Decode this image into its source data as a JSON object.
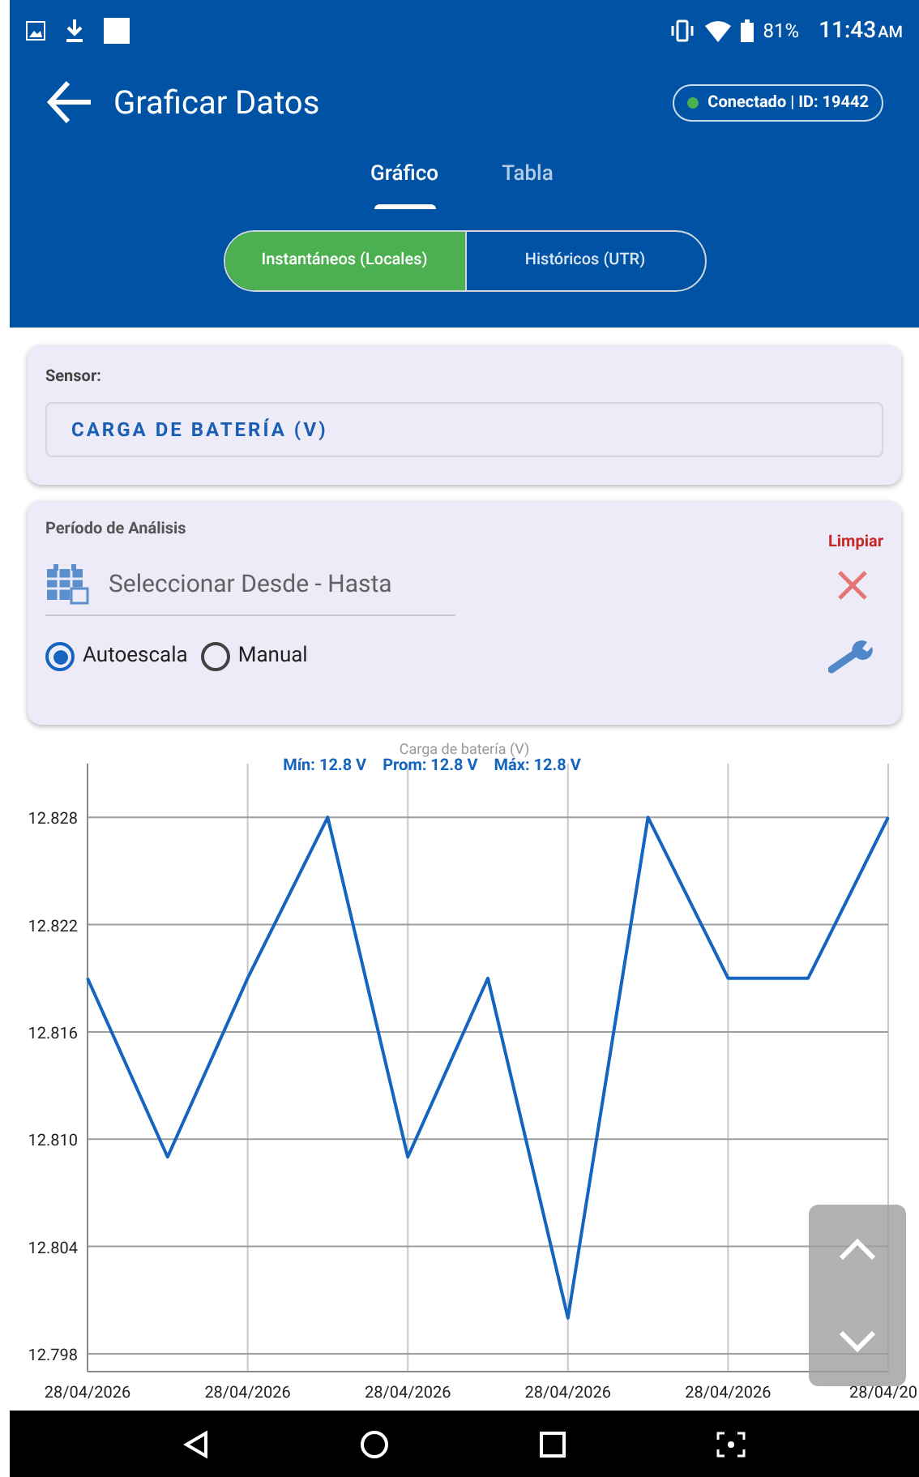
{
  "status_bar": {
    "battery": "81%",
    "time": "11:43",
    "meridiem": "AM"
  },
  "header": {
    "title": "Graficar Datos",
    "connection": {
      "label": "Conectado | ID: 19442",
      "connected": true
    }
  },
  "tabs": [
    {
      "label": "Gráfico",
      "selected": true
    },
    {
      "label": "Tabla",
      "selected": false
    }
  ],
  "source_toggle": [
    {
      "label": "Instantáneos (Locales)",
      "selected": true
    },
    {
      "label": "Históricos (UTR)",
      "selected": false
    }
  ],
  "sensor": {
    "label": "Sensor:",
    "value": "CARGA DE BATERÍA (V)"
  },
  "period": {
    "label": "Período de Análisis",
    "clear_label": "Limpiar",
    "placeholder": "Seleccionar Desde - Hasta"
  },
  "scale_options": [
    {
      "label": "Autoescala",
      "selected": true
    },
    {
      "label": "Manual",
      "selected": false
    }
  ],
  "chart": {
    "stats": [
      "Mín: 12.8 V",
      "Prom: 12.8 V",
      "Máx: 12.8 V"
    ],
    "chart_data": {
      "type": "line",
      "title": "Carga de batería (V)",
      "categories": [
        "28/04/2026",
        null,
        "28/04/2026",
        null,
        "28/04/2026",
        null,
        "28/04/2026",
        null,
        "28/04/2026",
        null,
        "28/04/20"
      ],
      "series": [
        {
          "color": "#1565c0",
          "values": [
            12.819,
            12.809,
            12.819,
            12.828,
            12.809,
            12.819,
            12.8,
            12.828,
            12.819,
            12.819,
            12.828
          ]
        }
      ],
      "ylim": [
        12.797,
        12.831
      ],
      "grid": true,
      "yticks": [
        {
          "value": 12.798,
          "label": "12.798"
        },
        {
          "value": 12.804,
          "label": "12.804"
        },
        {
          "value": 12.81,
          "label": "12.810"
        },
        {
          "value": 12.816,
          "label": "12.816"
        },
        {
          "value": 12.822,
          "label": "12.822"
        },
        {
          "value": 12.828,
          "label": "12.828"
        }
      ]
    }
  }
}
